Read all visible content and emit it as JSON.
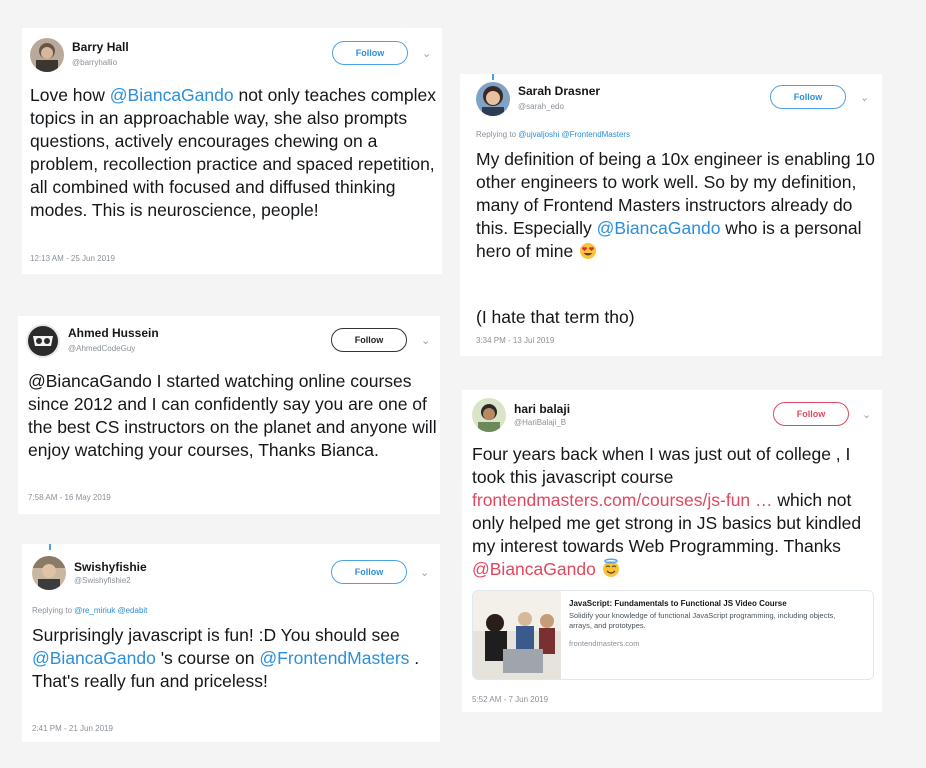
{
  "tweets": [
    {
      "name": "Barry Hall",
      "handle": "@barryhallio",
      "follow": "Follow",
      "chevron": "⌄",
      "text": [
        {
          "t": "Love how "
        },
        {
          "t": "@BiancaGando",
          "m": "mention"
        },
        {
          "t": " not only teaches complex topics in an approachable way, she also prompts questions, actively encourages chewing on a problem, recollection practice and spaced repetition, all combined with focused and diffused thinking modes. This is neuroscience, people!"
        }
      ],
      "timestamp": "12:13 AM - 25 Jun 2019"
    },
    {
      "name": "Ahmed Hussein",
      "handle": "@AhmedCodeGuy",
      "follow": "Follow",
      "chevron": "⌄",
      "text": [
        {
          "t": "@BiancaGando I started watching online courses since 2012 and I can confidently say you are one of the best CS instructors on the planet and anyone will enjoy watching your courses, Thanks Bianca."
        }
      ],
      "timestamp": "7:58 AM - 16 May 2019"
    },
    {
      "name": "Swishyfishie",
      "handle": "@Swishyfishie2",
      "follow": "Follow",
      "chevron": "⌄",
      "reply_prefix": "Replying to ",
      "reply_to": "@re_miriuk @edabit",
      "text": [
        {
          "t": "Surprisingly javascript is fun! :D You should see "
        },
        {
          "t": "@BiancaGando",
          "m": "mention"
        },
        {
          "t": " 's course on "
        },
        {
          "t": "@FrontendMasters",
          "m": "mention"
        },
        {
          "t": " . That's really fun and priceless!"
        }
      ],
      "timestamp": "2:41 PM - 21 Jun 2019"
    },
    {
      "name": "Sarah Drasner",
      "handle": "@sarah_edo",
      "follow": "Follow",
      "chevron": "⌄",
      "reply_prefix": "Replying to ",
      "reply_to": "@ujvaljoshi @FrontendMasters",
      "text": [
        {
          "t": "My definition of being a 10x engineer is enabling 10 other engineers to work well. So by my definition, many of Frontend Masters instructors already do this. Especially "
        },
        {
          "t": "@BiancaGando",
          "m": "mention"
        },
        {
          "t": " who is a personal hero of mine "
        },
        {
          "e": "heart-eyes-emoji"
        }
      ],
      "text2": "(I hate that term tho)",
      "timestamp": "3:34 PM - 13 Jul 2019"
    },
    {
      "name": "hari balaji",
      "handle": "@HariBalaji_B",
      "follow": "Follow",
      "chevron": "⌄",
      "text": [
        {
          "t": "Four years back when I was just out of college , I took this javascript course "
        },
        {
          "t": "frontendmasters.com/courses/js-fun …",
          "m": "mention red"
        },
        {
          "t": " which not only helped me get strong in JS basics but kindled my interest towards Web Programming. Thanks "
        },
        {
          "t": "@BiancaGando",
          "m": "mention red"
        },
        {
          "t": " "
        },
        {
          "e": "halo-emoji"
        }
      ],
      "link_card": {
        "title": "JavaScript: Fundamentals to Functional JS Video Course",
        "description": "Solidify your knowledge of functional JavaScript programming, including objects, arrays, and prototypes.",
        "domain": "frontendmasters.com"
      },
      "timestamp": "5:52 AM - 7 Jun 2019"
    }
  ]
}
